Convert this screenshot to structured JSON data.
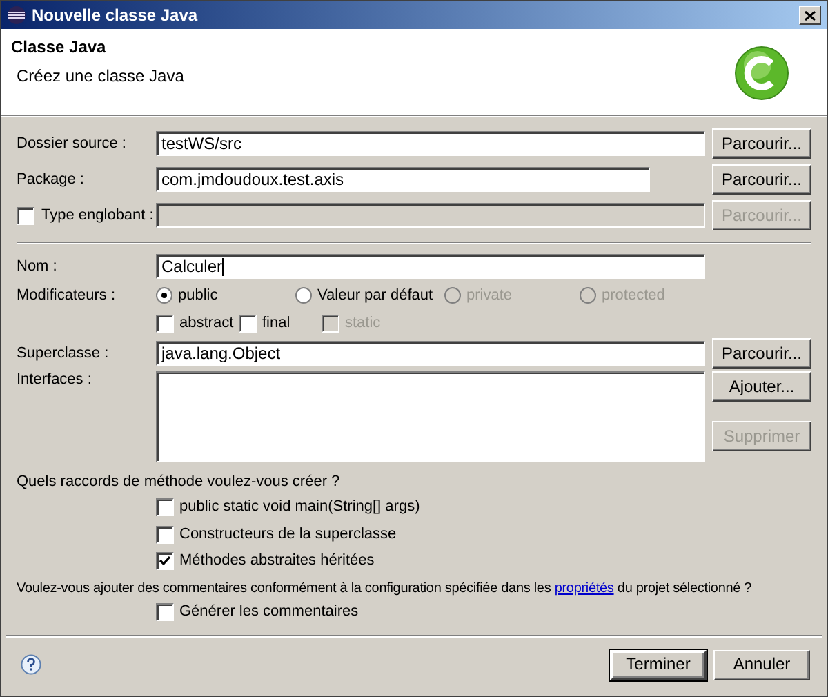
{
  "window": {
    "title": "Nouvelle classe Java"
  },
  "header": {
    "title": "Classe Java",
    "description": "Créez une classe Java"
  },
  "location_rows": [
    {
      "kind": "field",
      "label": "Dossier source :",
      "value": "testWS/src",
      "disabled": false,
      "button": {
        "label": "Parcourir...",
        "disabled": false
      }
    },
    {
      "kind": "field",
      "label": "Package :",
      "value": "com.jmdoudoux.test.axis",
      "disabled": false,
      "button": {
        "label": "Parcourir...",
        "disabled": false
      }
    },
    {
      "kind": "checkbox-field",
      "label": "Type englobant :",
      "checked": false,
      "disabled": true,
      "button": {
        "label": "Parcourir...",
        "disabled": true
      }
    }
  ],
  "name": {
    "label": "Nom :",
    "value": "Calculer"
  },
  "modifiers": {
    "label": "Modificateurs :",
    "access": [
      {
        "label": "public",
        "selected": true,
        "disabled": false
      },
      {
        "label": "Valeur par défaut",
        "selected": false,
        "disabled": false
      },
      {
        "label": "private",
        "selected": false,
        "disabled": true
      },
      {
        "label": "protected",
        "selected": false,
        "disabled": true
      }
    ],
    "flags": [
      {
        "label": "abstract",
        "checked": false,
        "disabled": false
      },
      {
        "label": "final",
        "checked": false,
        "disabled": false
      },
      {
        "label": "static",
        "checked": false,
        "disabled": true
      }
    ]
  },
  "superclass": {
    "label": "Superclasse :",
    "value": "java.lang.Object",
    "button": {
      "label": "Parcourir...",
      "disabled": false
    }
  },
  "interfaces": {
    "label": "Interfaces :",
    "buttons": [
      {
        "label": "Ajouter...",
        "disabled": false
      },
      {
        "label": "Supprimer",
        "disabled": true
      }
    ]
  },
  "stubs": {
    "question": "Quels raccords de méthode voulez-vous créer ?",
    "options": [
      {
        "label": "public static void main(String[] args)",
        "checked": false
      },
      {
        "label": "Constructeurs de la superclasse",
        "checked": false
      },
      {
        "label": "Méthodes abstraites héritées",
        "checked": true
      }
    ]
  },
  "comments": {
    "before": "Voulez-vous ajouter des commentaires conformément à la configuration spécifiée dans les",
    "link": "propriétés",
    "after": "du projet sélectionné ?",
    "option": {
      "label": "Générer les commentaires",
      "checked": false
    }
  },
  "footer": {
    "buttons": [
      {
        "label": "Terminer",
        "default": true
      },
      {
        "label": "Annuler",
        "default": false
      }
    ]
  }
}
